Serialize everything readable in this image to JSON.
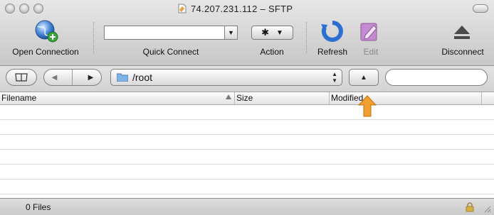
{
  "window": {
    "title": "74.207.231.112 – SFTP"
  },
  "toolbar": {
    "open_connection": "Open Connection",
    "quick_connect": "Quick Connect",
    "quick_connect_value": "",
    "action": "Action",
    "refresh": "Refresh",
    "edit": "Edit",
    "disconnect": "Disconnect"
  },
  "nav": {
    "path": "/root",
    "search_value": ""
  },
  "table": {
    "columns": [
      "Filename",
      "Size",
      "Modified"
    ]
  },
  "status": {
    "text": "0 Files"
  },
  "colors": {
    "refresh_blue": "#2d6fd0",
    "edit_purple": "#b070b8",
    "cursor_orange": "#f0a030"
  }
}
